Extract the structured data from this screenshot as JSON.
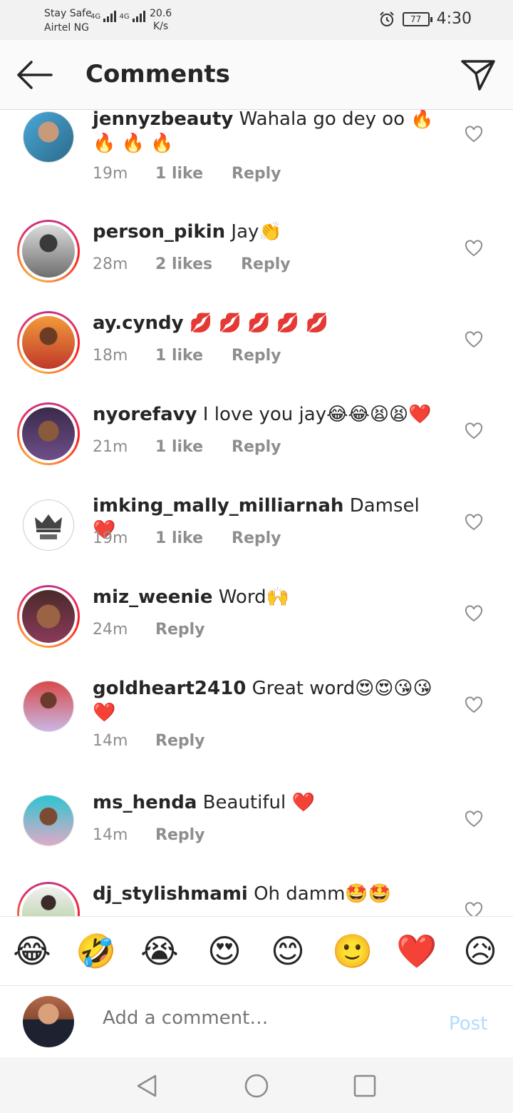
{
  "status_bar": {
    "line1": "Stay Safe",
    "carrier": "Airtel NG",
    "net_a": "4G",
    "net_b": "4G",
    "speed_value": "20.6",
    "speed_unit": "K/s",
    "battery": "77",
    "time": "4:30"
  },
  "header": {
    "title": "Comments"
  },
  "comments": [
    {
      "user": "jennyzbeauty",
      "text": "Wahala go dey oo 🔥 🔥 🔥 🔥",
      "time": "19m",
      "likes": "1 like",
      "reply": "Reply"
    },
    {
      "user": "person_pikin",
      "text": "Jay👏",
      "time": "28m",
      "likes": "2 likes",
      "reply": "Reply"
    },
    {
      "user": "ay.cyndy",
      "text": "💋 💋 💋 💋 💋",
      "time": "18m",
      "likes": "1 like",
      "reply": "Reply"
    },
    {
      "user": "nyorefavy",
      "text": "I love you jay😂😂😫😫❤️",
      "time": "21m",
      "likes": "1 like",
      "reply": "Reply"
    },
    {
      "user": "imking_mally_milliarnah",
      "text": "Damsel❤️",
      "time": "19m",
      "likes": "1 like",
      "reply": "Reply"
    },
    {
      "user": "miz_weenie",
      "text": "Word🙌",
      "time": "24m",
      "likes": "",
      "reply": "Reply"
    },
    {
      "user": "goldheart2410",
      "text": "Great word😍😍😘😘❤️",
      "time": "14m",
      "likes": "",
      "reply": "Reply"
    },
    {
      "user": "ms_henda",
      "text": "Beautiful ❤️",
      "time": "14m",
      "likes": "",
      "reply": "Reply"
    },
    {
      "user": "dj_stylishmami",
      "text": "Oh damm🤩🤩",
      "time": "",
      "likes": "",
      "reply": ""
    }
  ],
  "emoji_bar": [
    "😂",
    "🤣",
    "😭",
    "😍",
    "😊",
    "🙂",
    "❤️",
    "😥"
  ],
  "composer": {
    "placeholder": "Add a comment…",
    "post_label": "Post"
  },
  "colors": {
    "accent_disabled": "#b3dbff",
    "meta_gray": "#8e8e8e",
    "text": "#262626"
  }
}
